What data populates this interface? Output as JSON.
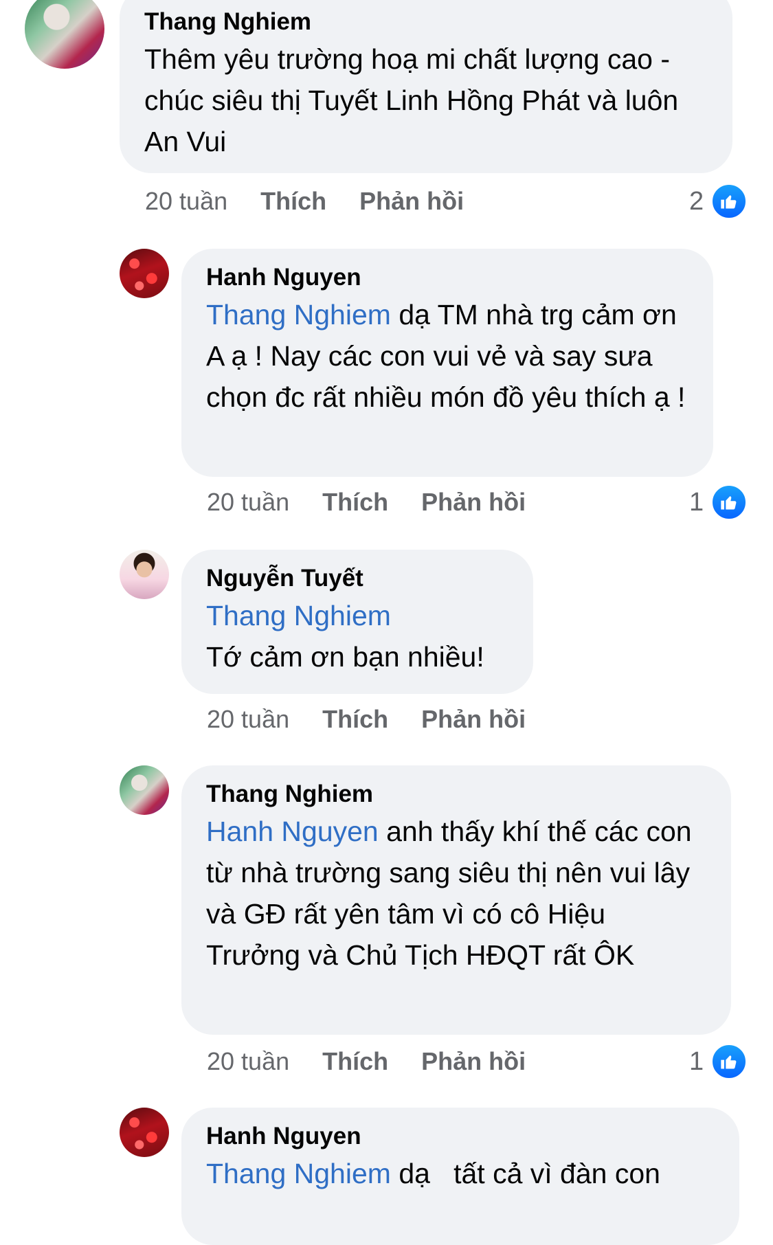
{
  "comments": [
    {
      "author": "Thang Nghiem",
      "mention": "",
      "text": "Thêm yêu trường hoạ mi chất lượng cao - chúc siêu thị Tuyết Linh Hồng Phát và luôn An Vui",
      "time": "20 tuần",
      "like_label": "Thích",
      "reply_label": "Phản hồi",
      "reactions": "2",
      "avatar_icon": "profile-photo-icon"
    },
    {
      "author": "Hanh Nguyen",
      "mention": "Thang Nghiem",
      "text": " dạ TM nhà trg cảm ơn A ạ ! Nay các con vui vẻ và say sưa chọn đc rất nhiều món đồ yêu thích ạ !",
      "time": "20 tuần",
      "like_label": "Thích",
      "reply_label": "Phản hồi",
      "reactions": "1"
    },
    {
      "author": "Nguyễn Tuyết",
      "mention": "Thang Nghiem",
      "text": "Tớ cảm ơn bạn nhiều!",
      "time": "20 tuần",
      "like_label": "Thích",
      "reply_label": "Phản hồi",
      "reactions": ""
    },
    {
      "author": "Thang Nghiem",
      "mention": "Hanh Nguyen",
      "text": " anh thấy khí thế các con từ nhà trường sang siêu thị nên vui lây và GĐ rất yên tâm vì có cô Hiệu Trưởng và Chủ Tịch HĐQT rất ÔK",
      "time": "20 tuần",
      "like_label": "Thích",
      "reply_label": "Phản hồi",
      "reactions": "1"
    },
    {
      "author": "Hanh Nguyen",
      "mention": "Thang Nghiem",
      "text": " dạ   tất cả vì đàn con"
    }
  ],
  "colors": {
    "mention": "#2f6ec5",
    "bubble": "#f0f2f5",
    "like": "#0866ff",
    "meta": "#65676b"
  }
}
